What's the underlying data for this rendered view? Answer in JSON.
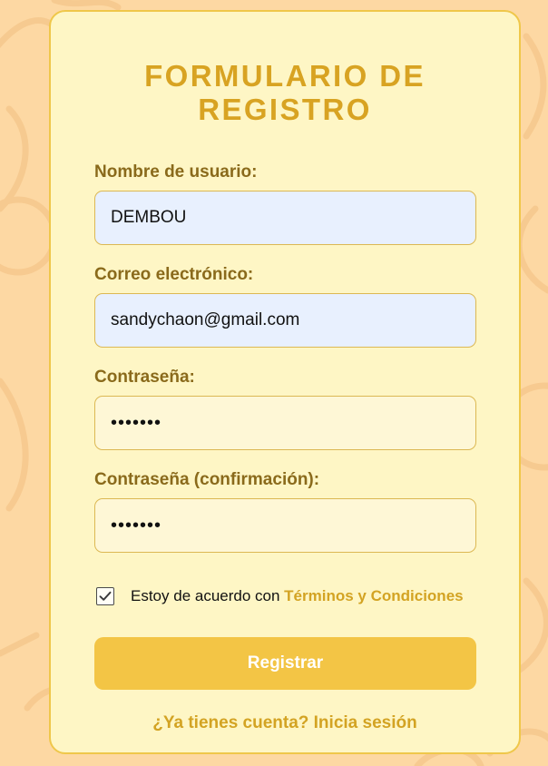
{
  "form": {
    "title": "FORMULARIO DE REGISTRO",
    "fields": {
      "username": {
        "label": "Nombre de usuario:",
        "value": "DEMBOU"
      },
      "email": {
        "label": "Correo electrónico:",
        "value": "sandychaon@gmail.com"
      },
      "password": {
        "label": "Contraseña:",
        "value": "•••••••"
      },
      "password_confirm": {
        "label": "Contraseña (confirmación):",
        "value": "•••••••"
      }
    },
    "terms": {
      "checked": true,
      "prefix": "Estoy de acuerdo con ",
      "link_text": "Términos y Condiciones"
    },
    "submit_label": "Registrar",
    "login_link": "¿Ya tienes cuenta? Inicia sesión"
  },
  "icons": {
    "checkbox": "check-icon"
  },
  "colors": {
    "page_bg": "#fdd8a3",
    "card_bg": "#fef6c5",
    "accent": "#d8a322",
    "label": "#8a6a1b",
    "button": "#f3c545",
    "autofill_bg": "#e8f0fe"
  }
}
